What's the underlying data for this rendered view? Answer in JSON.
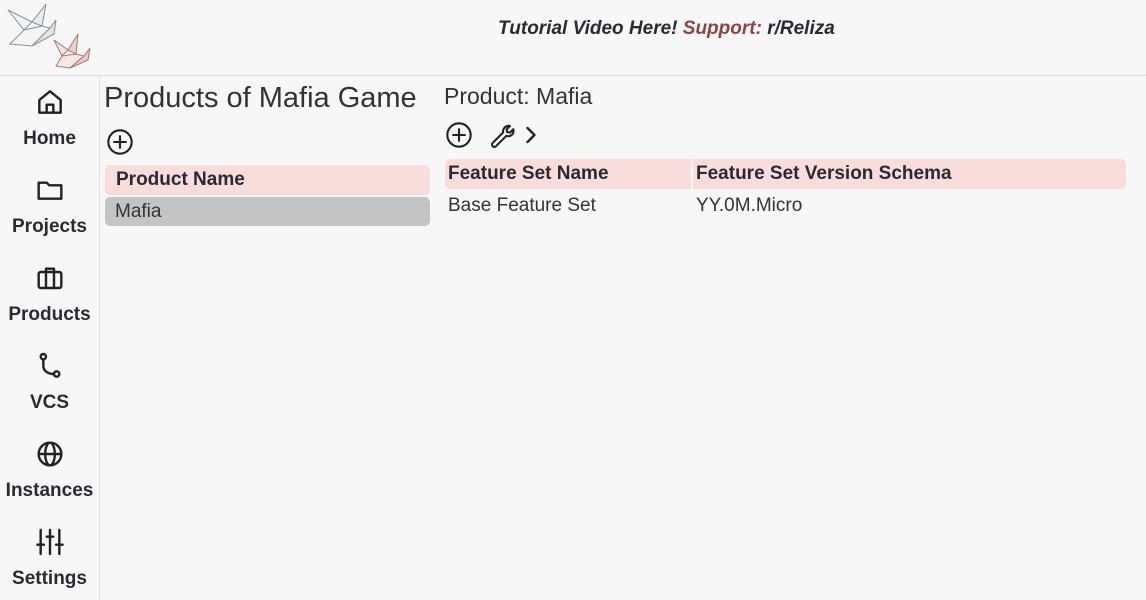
{
  "header": {
    "banner_main": "Tutorial Video Here!",
    "banner_support_label": "Support:",
    "banner_support_link": "r/Reliza"
  },
  "sidebar": {
    "items": [
      {
        "label": "Home",
        "icon": "home-icon"
      },
      {
        "label": "Projects",
        "icon": "folder-icon"
      },
      {
        "label": "Products",
        "icon": "briefcase-icon"
      },
      {
        "label": "VCS",
        "icon": "git-branch-icon"
      },
      {
        "label": "Instances",
        "icon": "globe-icon"
      },
      {
        "label": "Settings",
        "icon": "sliders-icon"
      }
    ]
  },
  "products_panel": {
    "title": "Products of Mafia Game",
    "column_header": "Product Name",
    "rows": [
      "Mafia"
    ]
  },
  "product_detail": {
    "title": "Product: Mafia",
    "columns": [
      "Feature Set Name",
      "Feature Set Version Schema"
    ],
    "rows": [
      {
        "name": "Base Feature Set",
        "schema": "YY.0M.Micro"
      }
    ]
  },
  "colors": {
    "header_row_bg": "#f9dcdc",
    "selected_row_bg": "#c4c4c4",
    "support_text": "#8a4545"
  }
}
